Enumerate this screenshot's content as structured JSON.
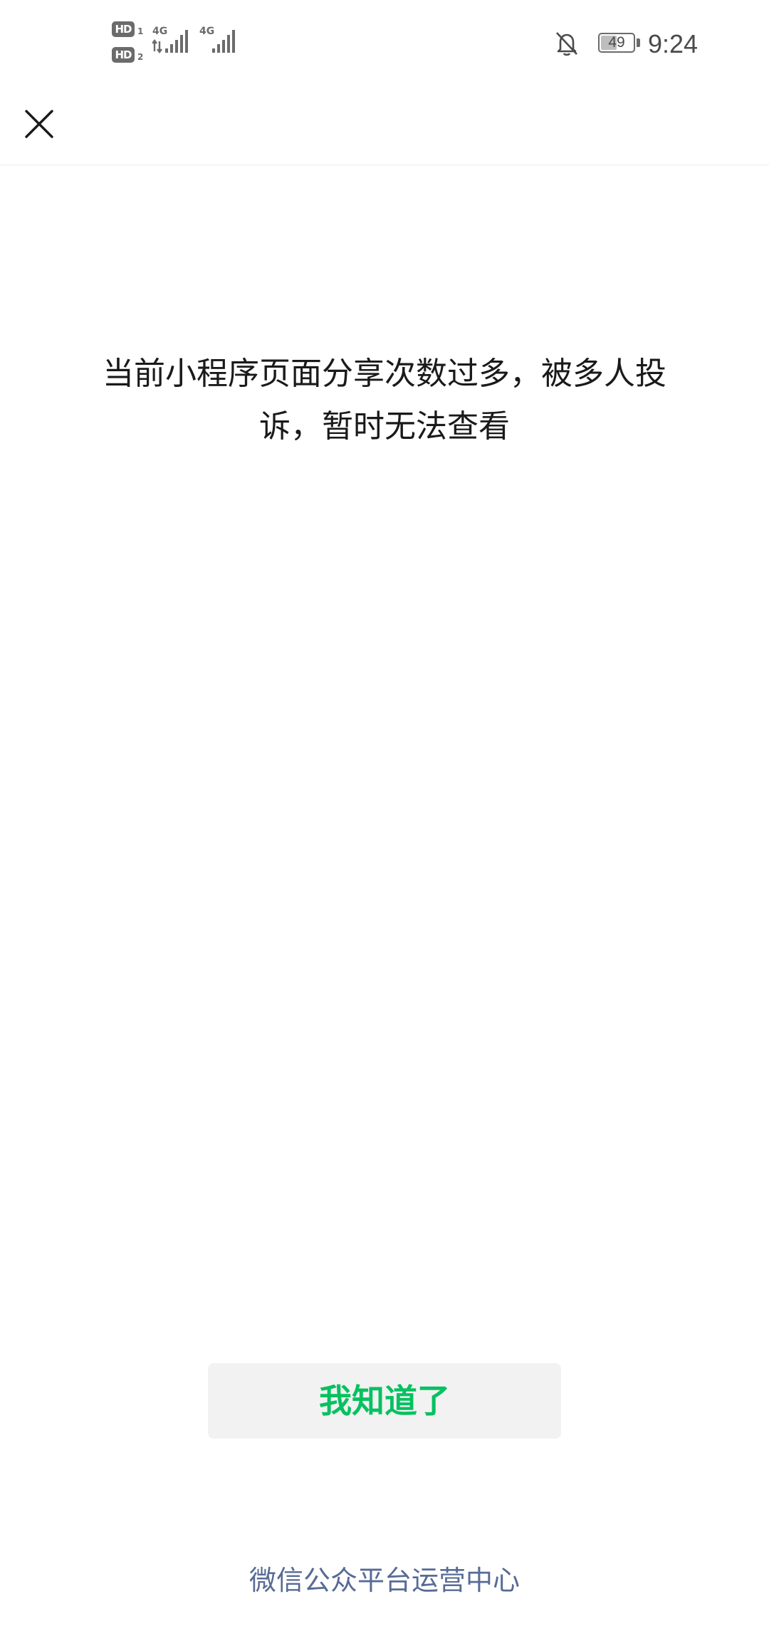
{
  "status_bar": {
    "sim1_badge": "HD",
    "sim1_slot": "1",
    "sim2_badge": "HD",
    "sim2_slot": "2",
    "sim1_network": "4G",
    "sim2_network": "4G",
    "battery_level": "49",
    "time": "9:24",
    "icons": [
      "hd-icon",
      "signal-icon",
      "bell-muted-icon",
      "battery-icon"
    ]
  },
  "nav_bar": {
    "close_icon": "close-icon"
  },
  "content": {
    "message": "当前小程序页面分享次数过多，被多人投诉，暂时无法查看"
  },
  "actions": {
    "confirm_label": "我知道了"
  },
  "footer": {
    "link_label": "微信公众平台运营中心"
  },
  "colors": {
    "accent_green": "#07c160",
    "link_blue": "#576b95",
    "button_bg": "#f2f2f2"
  }
}
